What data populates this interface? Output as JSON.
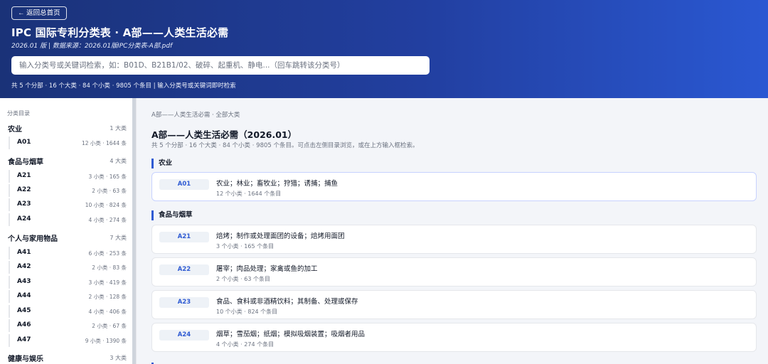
{
  "header": {
    "back_label": "← 返回总首页",
    "title": "IPC 国际专利分类表 · A部——人类生活必需",
    "subtitle": "2026.01 版 | 数据来源：2026.01版IPC分类表-A部.pdf",
    "search_placeholder": "输入分类号或关键词检索，如：B01D、B21B1/02、破碎、起重机、静电...（回车跳转该分类号）",
    "stats": "共 5 个分部 · 16 个大类 · 84 个小类 · 9805 个条目 | 输入分类号或关键词即时检索"
  },
  "sidebar": {
    "title": "分类目录",
    "sections": [
      {
        "name": "农业",
        "count": "1 大类",
        "items": [
          {
            "code": "A01",
            "meta": "12 小类 · 1644 条"
          }
        ]
      },
      {
        "name": "食品与烟草",
        "count": "4 大类",
        "items": [
          {
            "code": "A21",
            "meta": "3 小类 · 165 条"
          },
          {
            "code": "A22",
            "meta": "2 小类 · 63 条"
          },
          {
            "code": "A23",
            "meta": "10 小类 · 824 条"
          },
          {
            "code": "A24",
            "meta": "4 小类 · 274 条"
          }
        ]
      },
      {
        "name": "个人与家用物品",
        "count": "7 大类",
        "items": [
          {
            "code": "A41",
            "meta": "6 小类 · 253 条"
          },
          {
            "code": "A42",
            "meta": "2 小类 · 83 条"
          },
          {
            "code": "A43",
            "meta": "3 小类 · 419 条"
          },
          {
            "code": "A44",
            "meta": "2 小类 · 128 条"
          },
          {
            "code": "A45",
            "meta": "4 小类 · 406 条"
          },
          {
            "code": "A46",
            "meta": "2 小类 · 67 条"
          },
          {
            "code": "A47",
            "meta": "9 小类 · 1390 条"
          }
        ]
      },
      {
        "name": "健康与娱乐",
        "count": "3 大类",
        "items": []
      }
    ]
  },
  "main": {
    "breadcrumb": "A部——人类生活必需 · 全部大类",
    "title": "A部——人类生活必需（2026.01）",
    "description": "共 5 个分部 · 16 个大类 · 84 个小类 · 9805 个条目。可点击左侧目录浏览，或在上方输入框检索。",
    "groups": [
      {
        "name": "农业",
        "cards": [
          {
            "code": "A01",
            "desc": "农业；林业；畜牧业；狩猎；诱捕；捕鱼",
            "sub": "12 个小类 · 1644 个条目"
          }
        ]
      },
      {
        "name": "食品与烟草",
        "cards": [
          {
            "code": "A21",
            "desc": "焙烤；制作或处理面团的设备；焙烤用面团",
            "sub": "3 个小类 · 165 个条目"
          },
          {
            "code": "A22",
            "desc": "屠宰；肉品处理；家禽或鱼的加工",
            "sub": "2 个小类 · 63 个条目"
          },
          {
            "code": "A23",
            "desc": "食品、食料或非酒精饮料；其制备、处理或保存",
            "sub": "10 个小类 · 824 个条目"
          },
          {
            "code": "A24",
            "desc": "烟草；雪茄烟；纸烟；模拟吸烟装置；吸烟者用品",
            "sub": "4 个小类 · 274 个条目"
          }
        ]
      }
    ]
  }
}
